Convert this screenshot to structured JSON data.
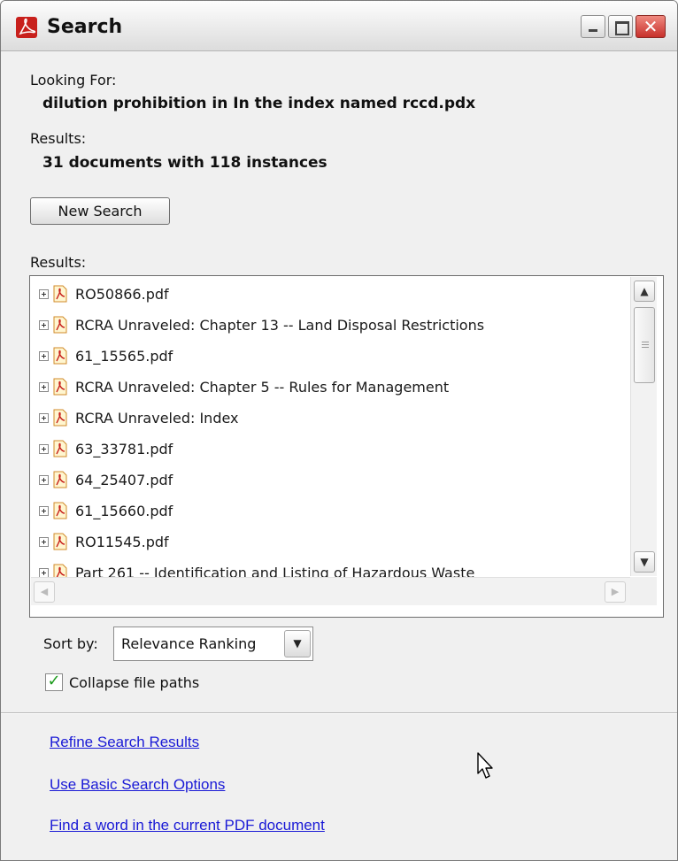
{
  "window": {
    "title": "Search",
    "icon": "adobe-reader-icon",
    "controls": [
      "minimize-icon",
      "maximize-icon",
      "close-icon"
    ]
  },
  "query": {
    "looking_for_label": "Looking For:",
    "looking_for_value": "dilution prohibition in In the index named rccd.pdx",
    "results_label": "Results:",
    "results_summary": "31 documents with 118 instances"
  },
  "new_search_label": "New Search",
  "results_list": {
    "label": "Results:",
    "items": [
      {
        "label": "RO50866.pdf"
      },
      {
        "label": "RCRA Unraveled: Chapter 13 -- Land Disposal Restrictions"
      },
      {
        "label": "61_15565.pdf"
      },
      {
        "label": "RCRA Unraveled: Chapter 5 -- Rules for Management"
      },
      {
        "label": "RCRA Unraveled: Index"
      },
      {
        "label": "63_33781.pdf"
      },
      {
        "label": "64_25407.pdf"
      },
      {
        "label": "61_15660.pdf"
      },
      {
        "label": "RO11545.pdf"
      },
      {
        "label": "Part 261 -- Identification and Listing of Hazardous Waste"
      }
    ]
  },
  "sort": {
    "label": "Sort by:",
    "value": "Relevance Ranking"
  },
  "collapse_paths": {
    "label": "Collapse file paths",
    "checked": true
  },
  "links": {
    "refine": "Refine Search Results",
    "basic": "Use Basic Search Options",
    "find_word": "Find a word in the current PDF document"
  },
  "colors": {
    "link": "#1a1ad6",
    "close_button": "#c7302b",
    "check_mark": "#1d9b1d"
  }
}
